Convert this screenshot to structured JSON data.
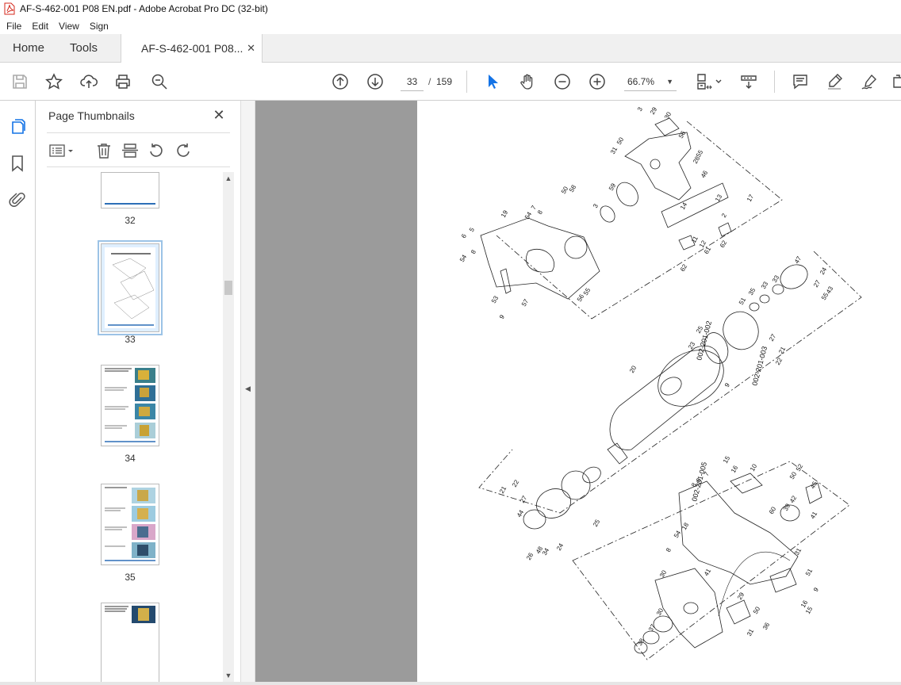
{
  "window": {
    "title": "AF-S-462-001 P08 EN.pdf - Adobe Acrobat Pro DC (32-bit)"
  },
  "menu": {
    "items": [
      "File",
      "Edit",
      "View",
      "Sign"
    ]
  },
  "tabs": {
    "home": "Home",
    "tools": "Tools",
    "document": "AF-S-462-001 P08...",
    "close_glyph": "✕"
  },
  "toolbar": {
    "page_current": "33",
    "page_separator": "/",
    "page_total": "159",
    "zoom": "66.7%",
    "icons": [
      "save-icon",
      "star-icon",
      "upload-icon",
      "print-icon",
      "zoom-search-icon",
      "page-up-icon",
      "page-down-icon",
      "select-cursor-icon",
      "hand-icon",
      "zoom-out-icon",
      "zoom-in-icon",
      "fit-page-icon",
      "scroll-mode-icon",
      "comment-icon",
      "highlight-icon",
      "sign-icon"
    ]
  },
  "thumbnails_panel": {
    "title": "Page Thumbnails",
    "close_glyph": "✕",
    "pages": [
      {
        "label": "32"
      },
      {
        "label": "33",
        "selected": true
      },
      {
        "label": "34"
      },
      {
        "label": "35"
      },
      {
        "label": ""
      }
    ]
  },
  "drawing": {
    "labels": [
      "3",
      "29",
      "30",
      "31",
      "50",
      "56",
      "55",
      "28",
      "46",
      "59",
      "50",
      "58",
      "3",
      "14",
      "13",
      "17",
      "2",
      "19",
      "54",
      "8",
      "7",
      "6",
      "5",
      "54",
      "8",
      "11",
      "12",
      "61",
      "62",
      "62",
      "53",
      "57",
      "9",
      "56",
      "55",
      "47",
      "24",
      "27",
      "43",
      "55",
      "35",
      "33",
      "33",
      "51",
      "25",
      "27",
      "21",
      "22",
      "23",
      "20",
      "9",
      "002-201-003",
      "15",
      "16",
      "10",
      "7",
      "6",
      "8",
      "52",
      "50",
      "45",
      "42",
      "60",
      "39",
      "41",
      "54",
      "8",
      "18",
      "31",
      "51",
      "9",
      "15",
      "16",
      "21",
      "22",
      "27",
      "44",
      "26",
      "48",
      "24",
      "25",
      "002-201-002",
      "002-201-005",
      "34",
      "41",
      "30",
      "29",
      "50",
      "31",
      "36",
      "38",
      "37",
      "30"
    ]
  },
  "colors": {
    "accent": "#2d6fb7",
    "select_cursor": "#1473e6",
    "doc_background": "#9b9b9b"
  }
}
